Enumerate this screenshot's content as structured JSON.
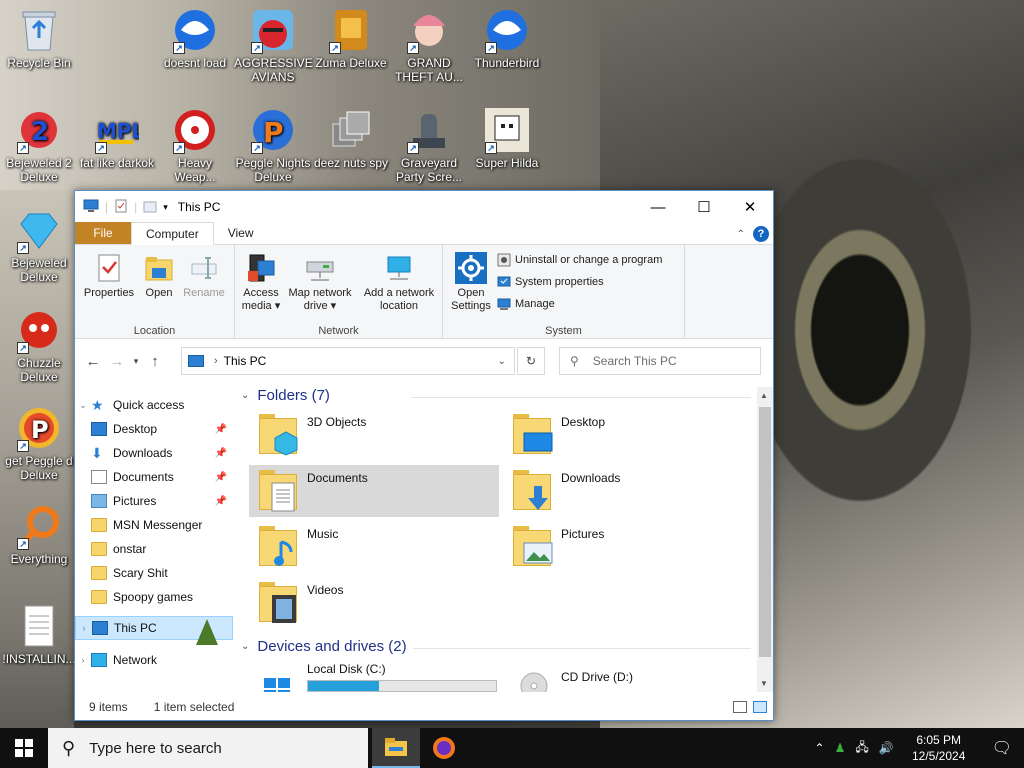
{
  "desktop": {
    "icons": [
      {
        "label": "Recycle Bin"
      },
      {
        "label": "doesnt load"
      },
      {
        "label": "AGGRESSIVE AVIANS"
      },
      {
        "label": "Zuma Deluxe"
      },
      {
        "label": "GRAND THEFT AU..."
      },
      {
        "label": "Thunderbird"
      },
      {
        "label": "Bejeweled 2 Deluxe"
      },
      {
        "label": "fat like darkok"
      },
      {
        "label": "Heavy Weap..."
      },
      {
        "label": "Peggle Nights Deluxe"
      },
      {
        "label": "deez nuts spy"
      },
      {
        "label": "Graveyard Party Scre..."
      },
      {
        "label": "Super Hilda"
      },
      {
        "label": "Bejeweled Deluxe"
      },
      {
        "label": "Chuzzle Deluxe"
      },
      {
        "label": "get Peggle d Deluxe"
      },
      {
        "label": "Everything"
      },
      {
        "label": "!INSTALLIN..."
      }
    ]
  },
  "window": {
    "title": "This PC",
    "tabs": [
      {
        "label": "File"
      },
      {
        "label": "Computer"
      },
      {
        "label": "View"
      }
    ],
    "ribbon": {
      "location": {
        "label": "Location",
        "buttons": [
          {
            "label": "Properties"
          },
          {
            "label": "Open"
          },
          {
            "label": "Rename"
          }
        ]
      },
      "network": {
        "label": "Network",
        "buttons": [
          {
            "label": "Access media ▾"
          },
          {
            "label": "Map network drive ▾"
          },
          {
            "label": "Add a network location"
          }
        ]
      },
      "system": {
        "label": "System",
        "open_settings": "Open Settings",
        "items": [
          {
            "label": "Uninstall or change a program"
          },
          {
            "label": "System properties"
          },
          {
            "label": "Manage"
          }
        ]
      }
    },
    "address": {
      "path": "This PC",
      "search_placeholder": "Search This PC"
    },
    "nav": {
      "quick_access": "Quick access",
      "pinned": [
        {
          "label": "Desktop"
        },
        {
          "label": "Downloads"
        },
        {
          "label": "Documents"
        },
        {
          "label": "Pictures"
        }
      ],
      "folders": [
        {
          "label": "MSN Messenger"
        },
        {
          "label": "onstar"
        },
        {
          "label": "Scary Shit"
        },
        {
          "label": "Spoopy games"
        }
      ],
      "this_pc": "This PC",
      "network": "Network"
    },
    "content": {
      "folders_header": "Folders (7)",
      "folders": [
        {
          "label": "3D Objects"
        },
        {
          "label": "Desktop"
        },
        {
          "label": "Documents"
        },
        {
          "label": "Downloads"
        },
        {
          "label": "Music"
        },
        {
          "label": "Pictures"
        },
        {
          "label": "Videos"
        }
      ],
      "devices_header": "Devices and drives (2)",
      "drives": [
        {
          "label": "Local Disk (C:)",
          "usage": 0.38
        },
        {
          "label": "CD Drive (D:)"
        }
      ]
    },
    "status": {
      "items": "9 items",
      "selected": "1 item selected"
    }
  },
  "taskbar": {
    "search_placeholder": "Type here to search",
    "time": "6:05 PM",
    "date": "12/5/2024"
  },
  "colors": {
    "accent": "#0078d7",
    "file_tab": "#c18324",
    "selection": "#cce8ff"
  }
}
